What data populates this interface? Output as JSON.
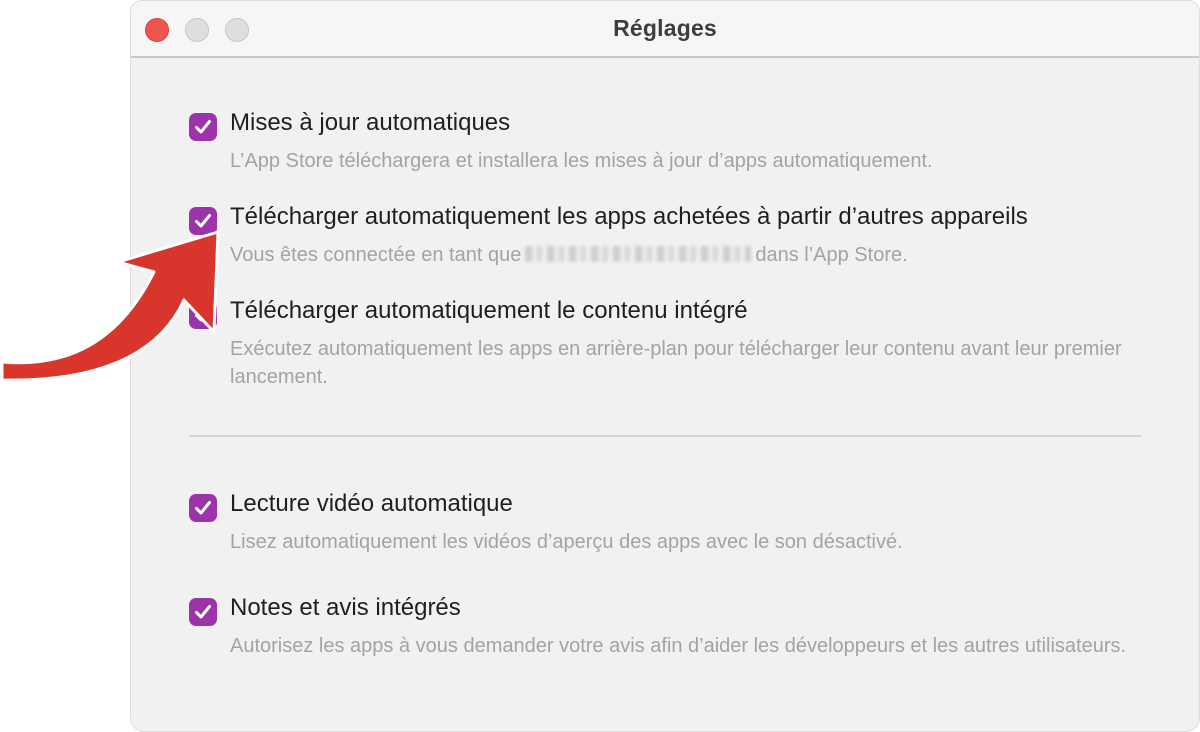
{
  "window": {
    "title": "Réglages"
  },
  "options": [
    {
      "label": "Mises à jour automatiques",
      "checked": true,
      "description": "L’App Store téléchargera et installera les mises à jour d’apps automatiquement."
    },
    {
      "label": "Télécharger automatiquement les apps achetées à partir d’autres appareils",
      "checked": true,
      "description_before": "Vous êtes connectée en tant que",
      "description_after": "dans l’App Store."
    },
    {
      "label": "Télécharger automatiquement le contenu intégré",
      "checked": true,
      "description": "Exécutez automatiquement les apps en arrière-plan pour télécharger leur contenu avant leur premier lancement."
    },
    {
      "label": "Lecture vidéo automatique",
      "checked": true,
      "description": "Lisez automatiquement les vidéos d’aperçu des apps avec le son désactivé."
    },
    {
      "label": "Notes et avis intégrés",
      "checked": true,
      "description": "Autorisez les apps à vous demander votre avis afin d’aider les développeurs et les autres utilisateurs."
    }
  ],
  "colors": {
    "checkbox": "#9c34a9",
    "arrow": "#d8352c",
    "close_button": "#ec5550"
  },
  "icons": {
    "checkbox": "checkmark-icon",
    "annotation": "curved-arrow-icon"
  }
}
